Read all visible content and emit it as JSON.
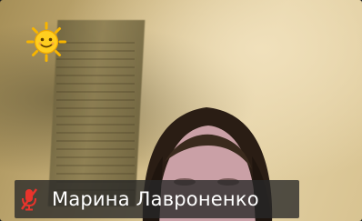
{
  "participant": {
    "name": "Марина Лавроненко",
    "mic_state": "muted",
    "mic_icon": "mic-muted-icon",
    "mic_color": "#e8342c"
  },
  "overlay": {
    "sticker_icon": "sun-icon"
  },
  "colors": {
    "name_bar_bg": "#282828",
    "name_text": "#ffffff"
  }
}
